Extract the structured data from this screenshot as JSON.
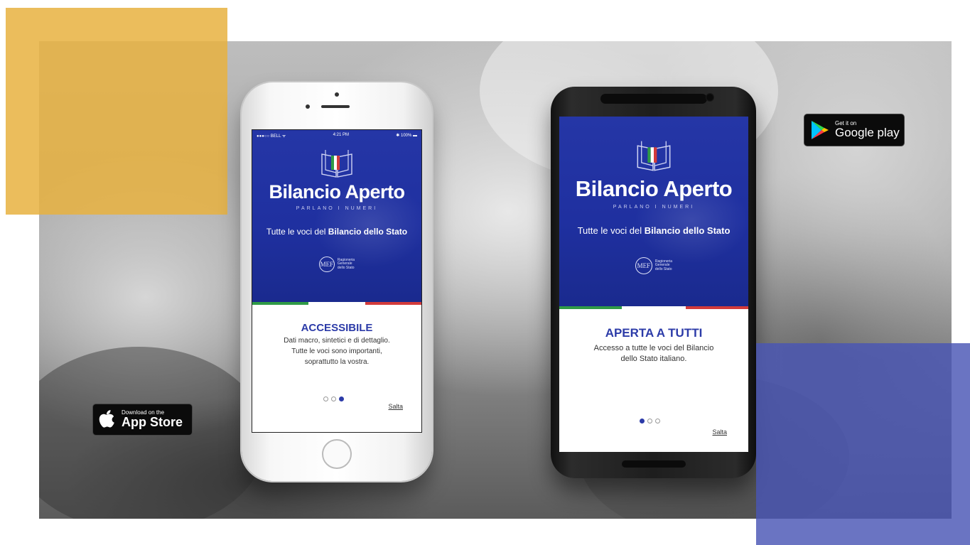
{
  "iphone": {
    "status": {
      "carrier": "●●●○○ BELL ᯤ",
      "time": "4:21 PM",
      "battery": "✱ 100% ▬"
    },
    "app_title": "Bilancio Aperto",
    "app_subtitle": "PARLANO I NUMERI",
    "tagline_prefix": "Tutte le voci del ",
    "tagline_bold": "Bilancio dello Stato",
    "mef_logo_text": "MEF",
    "mef_org": [
      "Ragioneria",
      "Generale",
      "dello Stato"
    ],
    "card_heading": "ACCESSIBILE",
    "card_lines": [
      "Dati macro, sintetici e di dettaglio.",
      "Tutte le voci sono importanti,",
      "soprattutto la vostra."
    ],
    "page_indicator": {
      "total": 3,
      "active": 3
    },
    "skip_label": "Salta"
  },
  "android": {
    "app_title": "Bilancio Aperto",
    "app_subtitle": "PARLANO I NUMERI",
    "tagline_prefix": "Tutte le voci del ",
    "tagline_bold": "Bilancio dello Stato",
    "mef_logo_text": "MEF",
    "mef_org": [
      "Ragioneria",
      "Generale",
      "dello Stato"
    ],
    "card_heading": "APERTA A TUTTI",
    "card_lines": [
      "Accesso a tutte le voci del Bilancio",
      "dello Stato italiano."
    ],
    "page_indicator": {
      "total": 3,
      "active": 1
    },
    "skip_label": "Salta"
  },
  "badges": {
    "app_store": {
      "small": "Download on the",
      "big": "App Store",
      "icon": "apple-icon"
    },
    "google_play": {
      "small": "Get it on",
      "big": "Google play",
      "icon": "play-triangle-icon"
    }
  },
  "colors": {
    "brand_blue": "#2536a6",
    "heading_blue": "#2c3ba8",
    "flag_green": "#2f9a46",
    "flag_red": "#d23b3b",
    "accent_yellow": "#e8b23f",
    "accent_indigo": "#4955b4"
  }
}
